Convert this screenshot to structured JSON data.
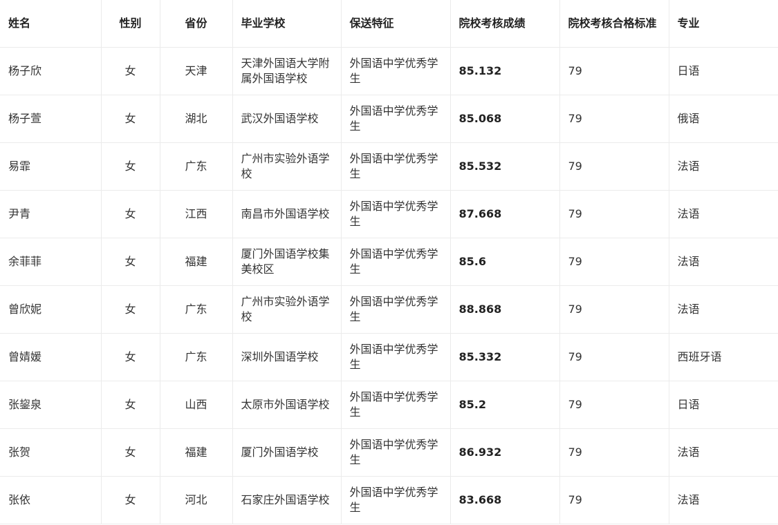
{
  "table": {
    "headers": [
      "姓名",
      "性别",
      "省份",
      "毕业学校",
      "保送特征",
      "院校考核成绩",
      "院校考核合格标准",
      "专业"
    ],
    "rows": [
      [
        "杨子欣",
        "女",
        "天津",
        "天津外国语大学附属外国语学校",
        "外国语中学优秀学生",
        "85.132",
        "79",
        "日语"
      ],
      [
        "杨子萱",
        "女",
        "湖北",
        "武汉外国语学校",
        "外国语中学优秀学生",
        "85.068",
        "79",
        "俄语"
      ],
      [
        "易霏",
        "女",
        "广东",
        "广州市实验外语学校",
        "外国语中学优秀学生",
        "85.532",
        "79",
        "法语"
      ],
      [
        "尹青",
        "女",
        "江西",
        "南昌市外国语学校",
        "外国语中学优秀学生",
        "87.668",
        "79",
        "法语"
      ],
      [
        "余菲菲",
        "女",
        "福建",
        "厦门外国语学校集美校区",
        "外国语中学优秀学生",
        "85.6",
        "79",
        "法语"
      ],
      [
        "曾欣妮",
        "女",
        "广东",
        "广州市实验外语学校",
        "外国语中学优秀学生",
        "88.868",
        "79",
        "法语"
      ],
      [
        "曾婧媛",
        "女",
        "广东",
        "深圳外国语学校",
        "外国语中学优秀学生",
        "85.332",
        "79",
        "西班牙语"
      ],
      [
        "张鋆泉",
        "女",
        "山西",
        "太原市外国语学校",
        "外国语中学优秀学生",
        "85.2",
        "79",
        "日语"
      ],
      [
        "张贺",
        "女",
        "福建",
        "厦门外国语学校",
        "外国语中学优秀学生",
        "86.932",
        "79",
        "法语"
      ],
      [
        "张依",
        "女",
        "河北",
        "石家庄外国语学校",
        "外国语中学优秀学生",
        "83.668",
        "79",
        "法语"
      ]
    ]
  },
  "colors": {
    "border": "#ebebeb",
    "text": "#333333",
    "header_text": "#222222"
  }
}
